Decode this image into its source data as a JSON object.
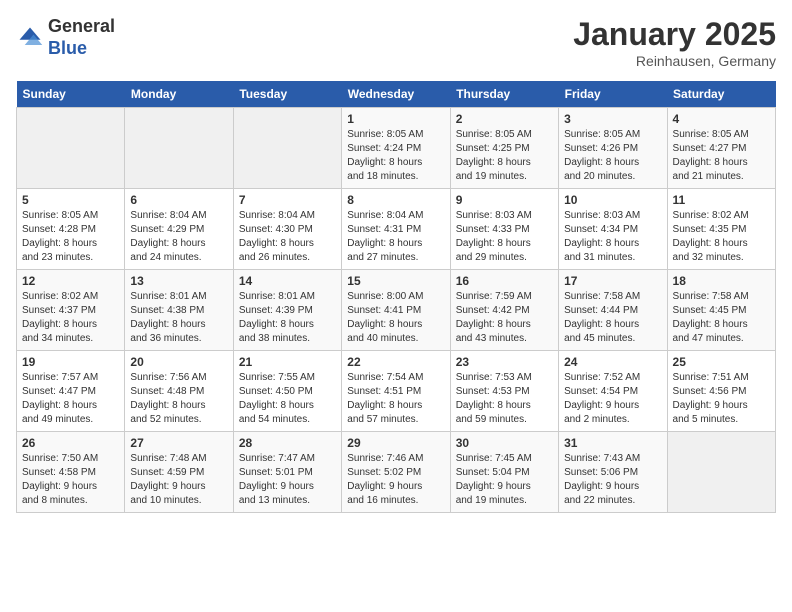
{
  "logo": {
    "general": "General",
    "blue": "Blue"
  },
  "header": {
    "title": "January 2025",
    "subtitle": "Reinhausen, Germany"
  },
  "weekdays": [
    "Sunday",
    "Monday",
    "Tuesday",
    "Wednesday",
    "Thursday",
    "Friday",
    "Saturday"
  ],
  "weeks": [
    [
      {
        "num": "",
        "info": ""
      },
      {
        "num": "",
        "info": ""
      },
      {
        "num": "",
        "info": ""
      },
      {
        "num": "1",
        "info": "Sunrise: 8:05 AM\nSunset: 4:24 PM\nDaylight: 8 hours\nand 18 minutes."
      },
      {
        "num": "2",
        "info": "Sunrise: 8:05 AM\nSunset: 4:25 PM\nDaylight: 8 hours\nand 19 minutes."
      },
      {
        "num": "3",
        "info": "Sunrise: 8:05 AM\nSunset: 4:26 PM\nDaylight: 8 hours\nand 20 minutes."
      },
      {
        "num": "4",
        "info": "Sunrise: 8:05 AM\nSunset: 4:27 PM\nDaylight: 8 hours\nand 21 minutes."
      }
    ],
    [
      {
        "num": "5",
        "info": "Sunrise: 8:05 AM\nSunset: 4:28 PM\nDaylight: 8 hours\nand 23 minutes."
      },
      {
        "num": "6",
        "info": "Sunrise: 8:04 AM\nSunset: 4:29 PM\nDaylight: 8 hours\nand 24 minutes."
      },
      {
        "num": "7",
        "info": "Sunrise: 8:04 AM\nSunset: 4:30 PM\nDaylight: 8 hours\nand 26 minutes."
      },
      {
        "num": "8",
        "info": "Sunrise: 8:04 AM\nSunset: 4:31 PM\nDaylight: 8 hours\nand 27 minutes."
      },
      {
        "num": "9",
        "info": "Sunrise: 8:03 AM\nSunset: 4:33 PM\nDaylight: 8 hours\nand 29 minutes."
      },
      {
        "num": "10",
        "info": "Sunrise: 8:03 AM\nSunset: 4:34 PM\nDaylight: 8 hours\nand 31 minutes."
      },
      {
        "num": "11",
        "info": "Sunrise: 8:02 AM\nSunset: 4:35 PM\nDaylight: 8 hours\nand 32 minutes."
      }
    ],
    [
      {
        "num": "12",
        "info": "Sunrise: 8:02 AM\nSunset: 4:37 PM\nDaylight: 8 hours\nand 34 minutes."
      },
      {
        "num": "13",
        "info": "Sunrise: 8:01 AM\nSunset: 4:38 PM\nDaylight: 8 hours\nand 36 minutes."
      },
      {
        "num": "14",
        "info": "Sunrise: 8:01 AM\nSunset: 4:39 PM\nDaylight: 8 hours\nand 38 minutes."
      },
      {
        "num": "15",
        "info": "Sunrise: 8:00 AM\nSunset: 4:41 PM\nDaylight: 8 hours\nand 40 minutes."
      },
      {
        "num": "16",
        "info": "Sunrise: 7:59 AM\nSunset: 4:42 PM\nDaylight: 8 hours\nand 43 minutes."
      },
      {
        "num": "17",
        "info": "Sunrise: 7:58 AM\nSunset: 4:44 PM\nDaylight: 8 hours\nand 45 minutes."
      },
      {
        "num": "18",
        "info": "Sunrise: 7:58 AM\nSunset: 4:45 PM\nDaylight: 8 hours\nand 47 minutes."
      }
    ],
    [
      {
        "num": "19",
        "info": "Sunrise: 7:57 AM\nSunset: 4:47 PM\nDaylight: 8 hours\nand 49 minutes."
      },
      {
        "num": "20",
        "info": "Sunrise: 7:56 AM\nSunset: 4:48 PM\nDaylight: 8 hours\nand 52 minutes."
      },
      {
        "num": "21",
        "info": "Sunrise: 7:55 AM\nSunset: 4:50 PM\nDaylight: 8 hours\nand 54 minutes."
      },
      {
        "num": "22",
        "info": "Sunrise: 7:54 AM\nSunset: 4:51 PM\nDaylight: 8 hours\nand 57 minutes."
      },
      {
        "num": "23",
        "info": "Sunrise: 7:53 AM\nSunset: 4:53 PM\nDaylight: 8 hours\nand 59 minutes."
      },
      {
        "num": "24",
        "info": "Sunrise: 7:52 AM\nSunset: 4:54 PM\nDaylight: 9 hours\nand 2 minutes."
      },
      {
        "num": "25",
        "info": "Sunrise: 7:51 AM\nSunset: 4:56 PM\nDaylight: 9 hours\nand 5 minutes."
      }
    ],
    [
      {
        "num": "26",
        "info": "Sunrise: 7:50 AM\nSunset: 4:58 PM\nDaylight: 9 hours\nand 8 minutes."
      },
      {
        "num": "27",
        "info": "Sunrise: 7:48 AM\nSunset: 4:59 PM\nDaylight: 9 hours\nand 10 minutes."
      },
      {
        "num": "28",
        "info": "Sunrise: 7:47 AM\nSunset: 5:01 PM\nDaylight: 9 hours\nand 13 minutes."
      },
      {
        "num": "29",
        "info": "Sunrise: 7:46 AM\nSunset: 5:02 PM\nDaylight: 9 hours\nand 16 minutes."
      },
      {
        "num": "30",
        "info": "Sunrise: 7:45 AM\nSunset: 5:04 PM\nDaylight: 9 hours\nand 19 minutes."
      },
      {
        "num": "31",
        "info": "Sunrise: 7:43 AM\nSunset: 5:06 PM\nDaylight: 9 hours\nand 22 minutes."
      },
      {
        "num": "",
        "info": ""
      }
    ]
  ]
}
